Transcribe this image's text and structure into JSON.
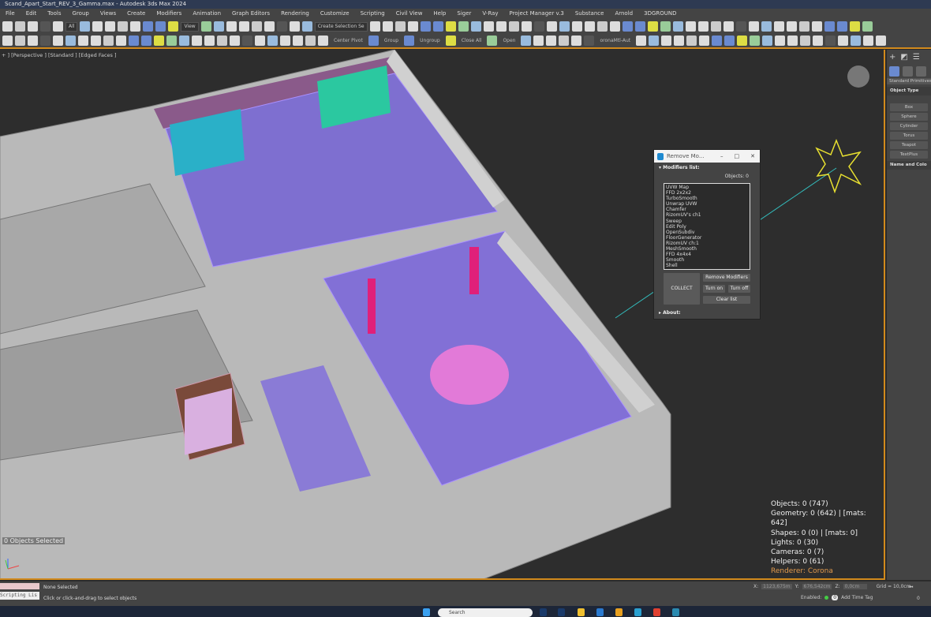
{
  "window": {
    "title": "Scand_Apart_Start_REV_3_Gamma.max - Autodesk 3ds Max 2024"
  },
  "menu": [
    "File",
    "Edit",
    "Tools",
    "Group",
    "Views",
    "Create",
    "Modifiers",
    "Animation",
    "Graph Editors",
    "Rendering",
    "Customize",
    "Scripting",
    "Civil View",
    "Help",
    "Siger",
    "V-Ray",
    "Project Manager v.3",
    "Substance",
    "Arnold",
    "3DGROUND"
  ],
  "toolbar": {
    "selection_filter": "All",
    "ref_coord": "View",
    "named_selection": "Create Selection Se",
    "center_pivot": "Center Pivot",
    "group": "Group",
    "ungroup": "Ungroup",
    "close_all": "Close All",
    "open": "Open",
    "corona_field": "oronaMtl-Aut"
  },
  "viewport": {
    "label": "+ ] [Perspective ] [Standard ] [Edged Faces ]",
    "selected": "0 Objects Selected",
    "stats": {
      "objects": "Objects: 0 (747)",
      "geometry": "Geometry: 0 (642)  | [mats: 642]",
      "shapes": "Shapes: 0 (0)  | [mats: 0]",
      "lights": "Lights: 0 (30)",
      "cameras": "Cameras: 0 (7)",
      "helpers": "Helpers: 0 (61)",
      "renderer": "Renderer: Corona"
    }
  },
  "command_panel": {
    "category": "Standard Primitives",
    "object_type": "Object Type",
    "buttons": [
      "Box",
      "Sphere",
      "Cylinder",
      "Torus",
      "Teapot",
      "TextPlus"
    ],
    "name_color": "Name and Colo"
  },
  "dialog": {
    "title": "Remove Mo...",
    "modifiers_header": "Modifiers list:",
    "objects": "Objects: 0",
    "modifiers": [
      "UVW Map",
      "FFD 2x2x2",
      "TurboSmooth",
      "Unwrap UVW",
      "Chamfer",
      "RizomUV's ch1",
      "Sweep",
      "Edit Poly",
      "OpenSubdiv",
      "FloorGenerator",
      "RizomUV ch:1",
      "MeshSmooth",
      "FFD 4x4x4",
      "Smooth",
      "Shell"
    ],
    "collect": "COLLECT",
    "remove": "Remove Modifiers",
    "turn_on": "Turn on",
    "turn_off": "Turn off",
    "clear": "Clear list",
    "about": "About:"
  },
  "status": {
    "listener": "Scripting Lis",
    "selection": "None Selected",
    "prompt": "Click or click-and-drag to select objects",
    "x": "1123,675m",
    "y": "676,542cm",
    "z": "0,0cm",
    "grid": "Grid = 10,0cm",
    "enabled": "Enabled:",
    "enabled_value": "0",
    "add_time_tag": "Add Time Tag",
    "frame": "0"
  },
  "taskbar": {
    "search": "Search"
  },
  "colors": {
    "accent": "#d28a1c",
    "renderer": "#e29a4c"
  }
}
